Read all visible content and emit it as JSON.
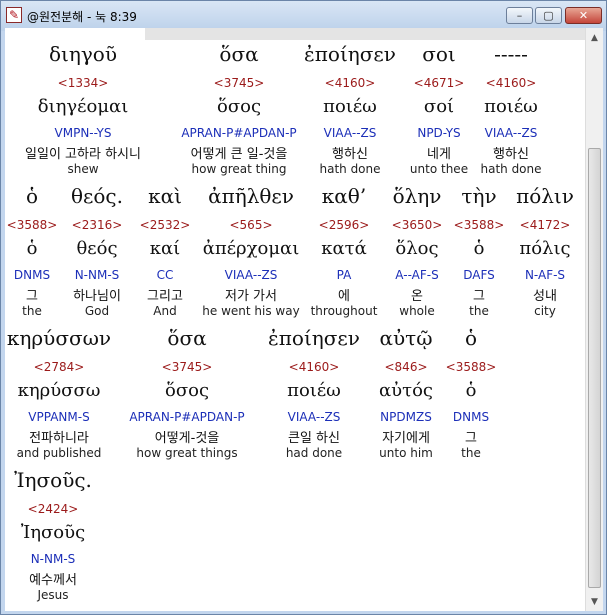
{
  "window": {
    "title": "@원전분해 - 눅 8:39",
    "min_label": "–",
    "max_label": "▢",
    "close_label": "✕"
  },
  "rows": [
    [
      {
        "greek": "διηγοῦ",
        "num": "<1334>",
        "lemma": "διηγέομαι",
        "parse": "VMPN--YS",
        "korean": "일일이 고하라 하시니",
        "english": "shew"
      },
      {
        "greek": "ὅσα",
        "num": "<3745>",
        "lemma": "ὅσος",
        "parse": "APRAN-P#APDAN-P",
        "korean": "어떻게 큰 일-것을",
        "english": "how great thing"
      },
      {
        "greek": "ἐποίησεν",
        "num": "<4160>",
        "lemma": "ποιέω",
        "parse": "VIAA--ZS",
        "korean": "행하신",
        "english": "hath done"
      },
      {
        "greek": "σοι",
        "num": "<4671>",
        "lemma": "σοί",
        "parse": "NPD-YS",
        "korean": "네게",
        "english": "unto thee"
      },
      {
        "greek": "-----",
        "num": "<4160>",
        "lemma": "ποιέω",
        "parse": "VIAA--ZS",
        "korean": "행하신",
        "english": "hath done"
      }
    ],
    [
      {
        "greek": "ὁ",
        "num": "<3588>",
        "lemma": "ὁ",
        "parse": "DNMS",
        "korean": "그",
        "english": "the"
      },
      {
        "greek": "θεός.",
        "num": "<2316>",
        "lemma": "θεός",
        "parse": "N-NM-S",
        "korean": "하나님이",
        "english": "God"
      },
      {
        "greek": "καὶ",
        "num": "<2532>",
        "lemma": "καί",
        "parse": "CC",
        "korean": "그리고",
        "english": "And"
      },
      {
        "greek": "ἀπῆλθεν",
        "num": "<565>",
        "lemma": "ἀπέρχομαι",
        "parse": "VIAA--ZS",
        "korean": "저가 가서",
        "english": "he went his way"
      },
      {
        "greek": "καθ’",
        "num": "<2596>",
        "lemma": "κατά",
        "parse": "PA",
        "korean": "에",
        "english": "throughout"
      },
      {
        "greek": "ὅλην",
        "num": "<3650>",
        "lemma": "ὅλος",
        "parse": "A--AF-S",
        "korean": "온",
        "english": "whole"
      },
      {
        "greek": "τὴν",
        "num": "<3588>",
        "lemma": "ὁ",
        "parse": "DAFS",
        "korean": "그",
        "english": "the"
      },
      {
        "greek": "πόλιν",
        "num": "<4172>",
        "lemma": "πόλις",
        "parse": "N-AF-S",
        "korean": "성내",
        "english": "city"
      }
    ],
    [
      {
        "greek": "κηρύσσων",
        "num": "<2784>",
        "lemma": "κηρύσσω",
        "parse": "VPPANM-S",
        "korean": "전파하니라",
        "english": "and published"
      },
      {
        "greek": "ὅσα",
        "num": "<3745>",
        "lemma": "ὅσος",
        "parse": "APRAN-P#APDAN-P",
        "korean": "어떻게-것을",
        "english": "how great things"
      },
      {
        "greek": "ἐποίησεν",
        "num": "<4160>",
        "lemma": "ποιέω",
        "parse": "VIAA--ZS",
        "korean": "큰일 하신",
        "english": "had done"
      },
      {
        "greek": "αὐτῷ",
        "num": "<846>",
        "lemma": "αὐτός",
        "parse": "NPDMZS",
        "korean": "자기에게",
        "english": "unto him"
      },
      {
        "greek": "ὁ",
        "num": "<3588>",
        "lemma": "ὁ",
        "parse": "DNMS",
        "korean": "그",
        "english": "the"
      }
    ],
    [
      {
        "greek": "Ἰησοῦς.",
        "num": "<2424>",
        "lemma": "Ἰησοῦς",
        "parse": "N-NM-S",
        "korean": "예수께서",
        "english": "Jesus"
      }
    ]
  ]
}
